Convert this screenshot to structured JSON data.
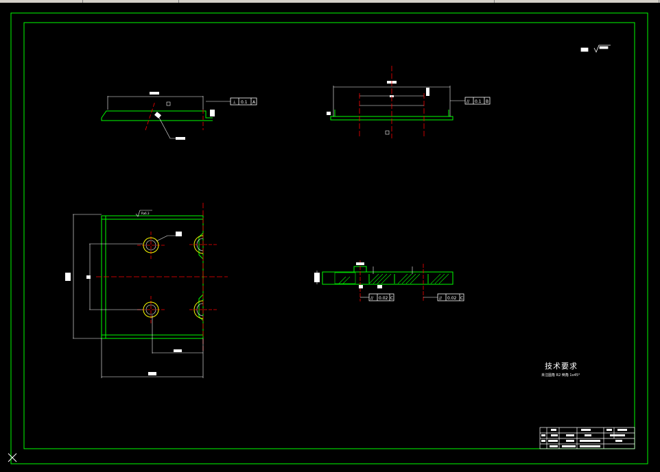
{
  "window": {
    "title": ""
  },
  "drawing": {
    "tech_requirements": {
      "title": "技术要求",
      "note": "未注圆角 R2 倒角 1x45°"
    },
    "tolerances": {
      "top_left_frame": [
        "⊥",
        "0.1",
        "A"
      ],
      "top_right_frame": [
        "//",
        "0.1",
        "B"
      ],
      "section_frame_1": [
        "//",
        "0.02",
        "C"
      ],
      "section_frame_2": [
        "//",
        "0.02",
        "C"
      ]
    },
    "roughness": {
      "top_plan": "Ra6.3"
    },
    "title_block": {
      "cells": [
        "",
        "",
        "",
        "",
        "",
        "",
        "",
        ""
      ]
    }
  },
  "colors": {
    "background": "#000000",
    "outline": "#00ff00",
    "centerline": "#ff0000",
    "dimension": "#ffffff",
    "hole": "#ffff00"
  },
  "icons": {
    "ucs": "ucs-axis-icon"
  }
}
